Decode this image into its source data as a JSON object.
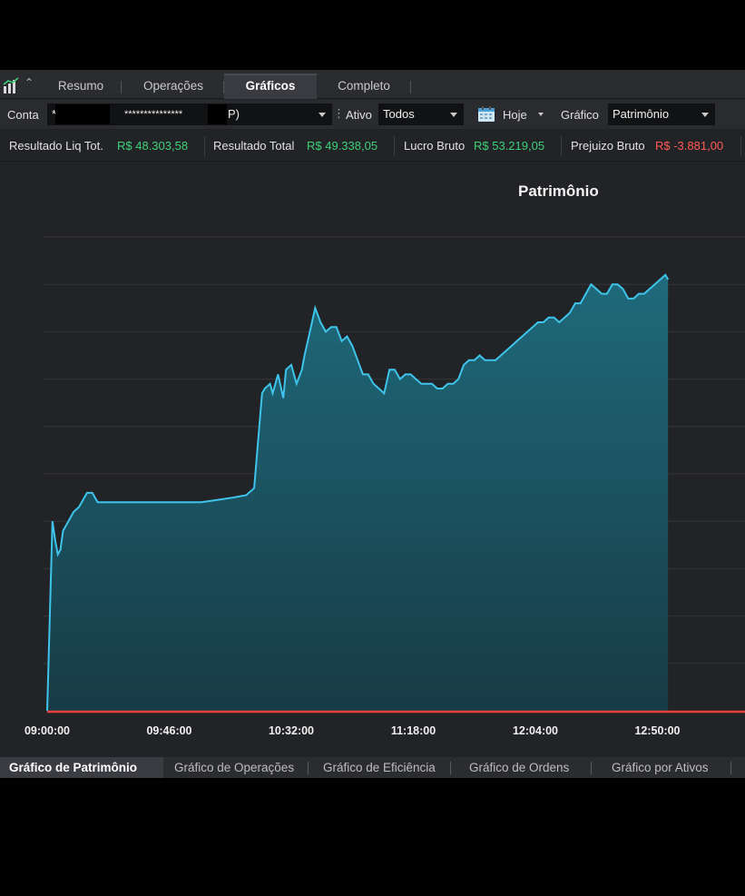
{
  "tabs": [
    {
      "label": "Resumo",
      "active": false
    },
    {
      "label": "Operações",
      "active": false
    },
    {
      "label": "Gráficos",
      "active": true
    },
    {
      "label": "Completo",
      "active": false
    }
  ],
  "filters": {
    "conta_label": "Conta",
    "conta_value_prefix": "*",
    "conta_value_mask": "***************",
    "conta_value_suffix": "P)",
    "ativo_label": "Ativo",
    "ativo_value": "Todos",
    "date_value": "Hoje",
    "grafico_label": "Gráfico",
    "grafico_value": "Patrimônio"
  },
  "summary": {
    "resultado_liq_label": "Resultado Liq Tot.",
    "resultado_liq_value": "R$ 48.303,58",
    "resultado_total_label": "Resultado Total",
    "resultado_total_value": "R$ 49.338,05",
    "lucro_bruto_label": "Lucro Bruto",
    "lucro_bruto_value": "R$ 53.219,05",
    "prejuizo_bruto_label": "Prejuizo Bruto",
    "prejuizo_bruto_value": "R$ -3.881,00"
  },
  "colors": {
    "line": "#3ec4ea",
    "fill_top": "#1f6e80",
    "fill_bottom": "#163e49",
    "zero_line": "#e8413c",
    "positive": "#3fd17a",
    "negative": "#ff5a55"
  },
  "chart_data": {
    "type": "area",
    "title": "Patrimônio",
    "xlabel": "",
    "ylabel": "",
    "x_ticks": [
      "09:00:00",
      "09:46:00",
      "10:32:00",
      "11:18:00",
      "12:04:00",
      "12:50:00"
    ],
    "x_range_minutes": [
      0,
      234
    ],
    "y_range": [
      0,
      100
    ],
    "grid": true,
    "x": [
      0,
      2,
      3,
      4,
      5,
      6,
      7,
      8,
      9,
      10,
      12,
      14,
      15,
      17,
      19,
      21,
      22,
      24,
      26,
      28,
      30,
      32,
      34,
      37,
      38,
      40,
      41,
      44,
      50,
      58,
      64,
      70,
      75,
      78,
      81,
      82,
      84,
      85,
      87,
      89,
      90,
      92,
      94,
      96,
      97,
      99,
      101,
      103,
      105,
      107,
      109,
      111,
      113,
      115,
      117,
      119,
      121,
      123,
      125,
      127,
      129,
      131,
      133,
      135,
      137,
      139,
      141,
      143,
      145,
      147,
      149,
      151,
      153,
      155,
      157,
      159,
      161,
      163,
      165,
      167,
      169,
      171,
      173,
      175,
      177,
      179,
      181,
      183,
      185,
      187,
      189,
      191,
      193,
      195,
      197,
      199,
      201,
      203,
      205,
      207,
      209,
      211,
      213,
      215,
      217,
      219,
      221,
      223,
      225,
      227,
      229,
      231,
      233,
      234
    ],
    "values": [
      0,
      40,
      36,
      33,
      34,
      38,
      39,
      40,
      41,
      42,
      43,
      45,
      46,
      46,
      44,
      44,
      44,
      44,
      44,
      44,
      44,
      44,
      44,
      44,
      44,
      44,
      44,
      44,
      44,
      44,
      44.5,
      45,
      45.5,
      47,
      67,
      68,
      69,
      67,
      71,
      66,
      72,
      73,
      69,
      72,
      75,
      80,
      85,
      82,
      80,
      81,
      81,
      78,
      79,
      77,
      74,
      71,
      71,
      69,
      68,
      67,
      72,
      72,
      70,
      71,
      71,
      70,
      69,
      69,
      69,
      68,
      68,
      69,
      69,
      70,
      73,
      74,
      74,
      75,
      74,
      74,
      74,
      75,
      76,
      77,
      78,
      79,
      80,
      81,
      82,
      82,
      83,
      83,
      82,
      83,
      84,
      86,
      86,
      88,
      90,
      89,
      88,
      88,
      90,
      90,
      89,
      87,
      87,
      88,
      88,
      89,
      90,
      91,
      92,
      91
    ]
  },
  "bottom_tabs": [
    {
      "label": "Gráfico de Patrimônio",
      "active": true
    },
    {
      "label": "Gráfico de Operações",
      "active": false
    },
    {
      "label": "Gráfico de Eficiência",
      "active": false
    },
    {
      "label": "Gráfico de Ordens",
      "active": false
    },
    {
      "label": "Gráfico por Ativos",
      "active": false
    }
  ],
  "icons": {
    "app": "bar-chart-icon",
    "collapse": "chevron-up-icon",
    "calendar": "calendar-icon",
    "dropdown": "caret-down-icon"
  }
}
